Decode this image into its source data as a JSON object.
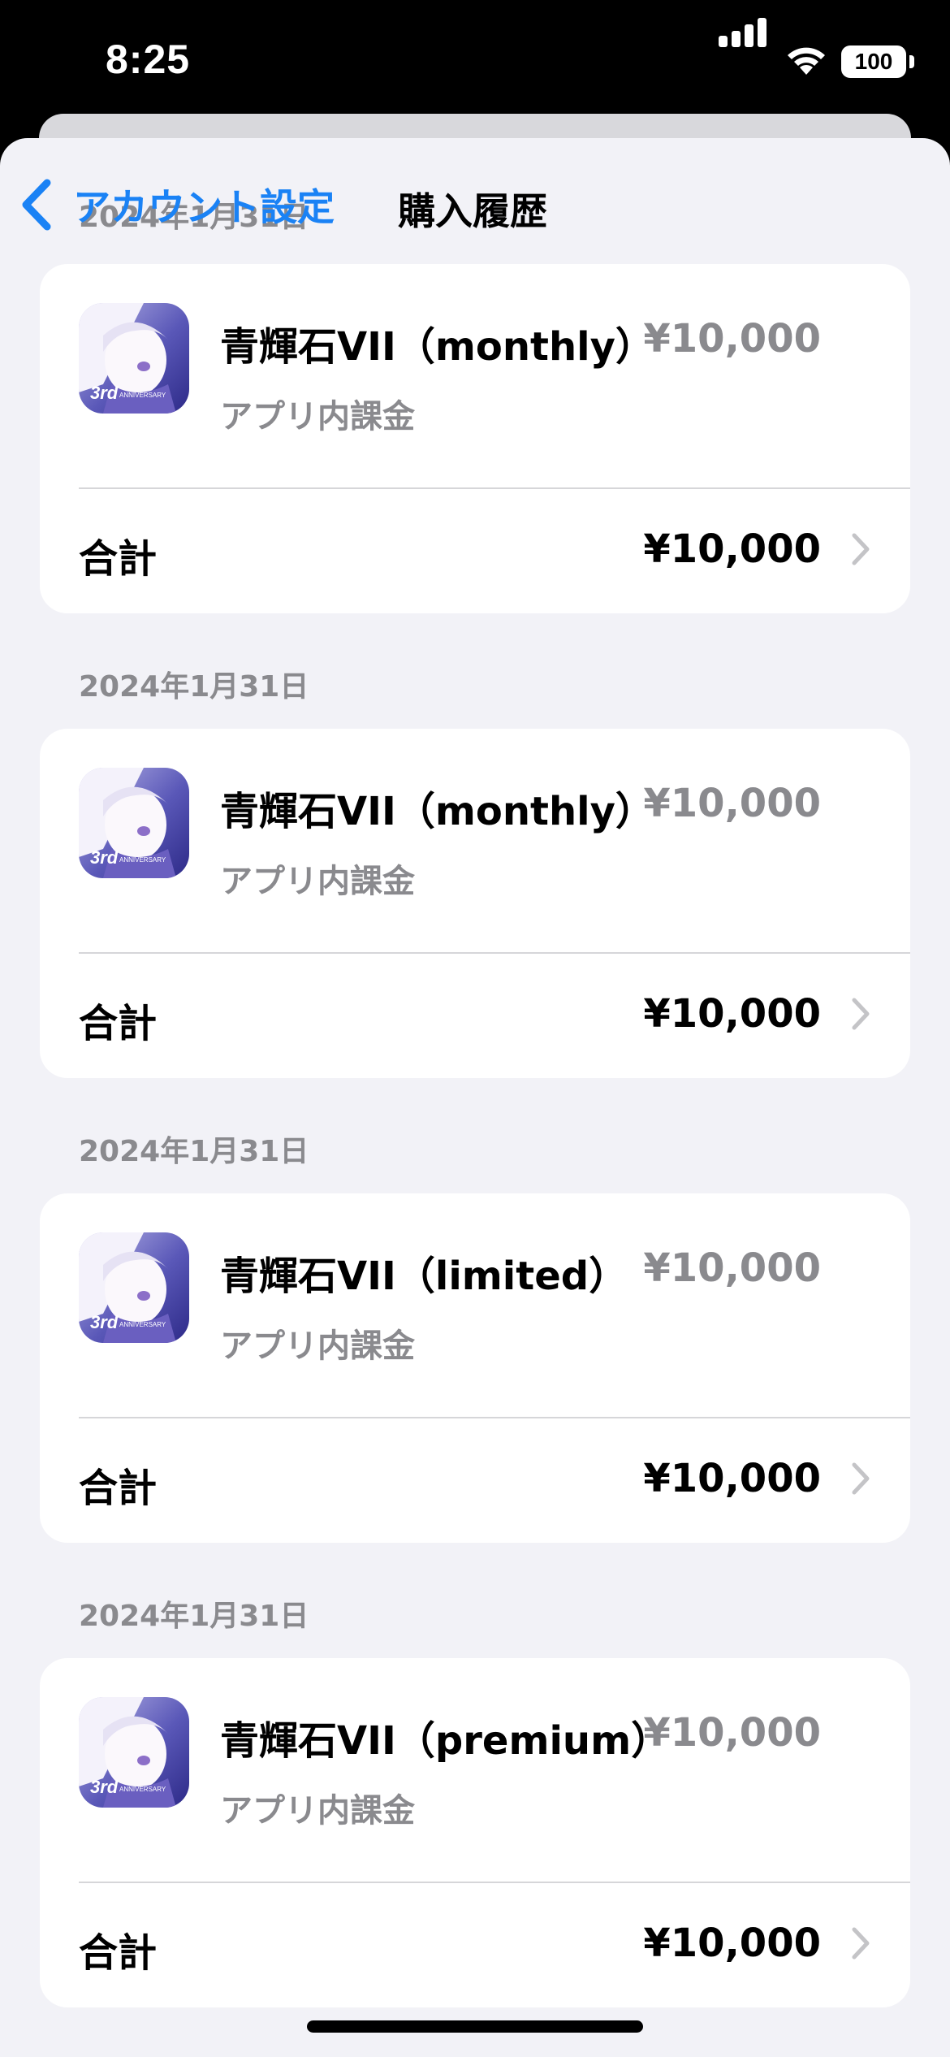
{
  "status": {
    "time": "8:25",
    "battery": "100"
  },
  "nav": {
    "back_label": "アカウント設定",
    "title": "購入履歴",
    "overlap_date": "2024年1月31日"
  },
  "purchases": [
    {
      "date": "2024年1月31日",
      "name": "青輝石VII（monthly）",
      "type": "アプリ内課金",
      "price": "¥10,000",
      "total_label": "合計",
      "total": "¥10,000"
    },
    {
      "date": "2024年1月31日",
      "name": "青輝石VII（monthly）",
      "type": "アプリ内課金",
      "price": "¥10,000",
      "total_label": "合計",
      "total": "¥10,000"
    },
    {
      "date": "2024年1月31日",
      "name": "青輝石VII（limited）",
      "type": "アプリ内課金",
      "price": "¥10,000",
      "total_label": "合計",
      "total": "¥10,000"
    },
    {
      "date": "2024年1月31日",
      "name": "青輝石VII（premium）",
      "type": "アプリ内課金",
      "price": "¥10,000",
      "total_label": "合計",
      "total": "¥10,000"
    }
  ],
  "icon_badge": "3rd",
  "icon_badge_sub": "ANNIVERSARY",
  "colors": {
    "accent": "#1a82f5",
    "background": "#f2f2f7",
    "secondary_text": "#8a8a8e"
  }
}
